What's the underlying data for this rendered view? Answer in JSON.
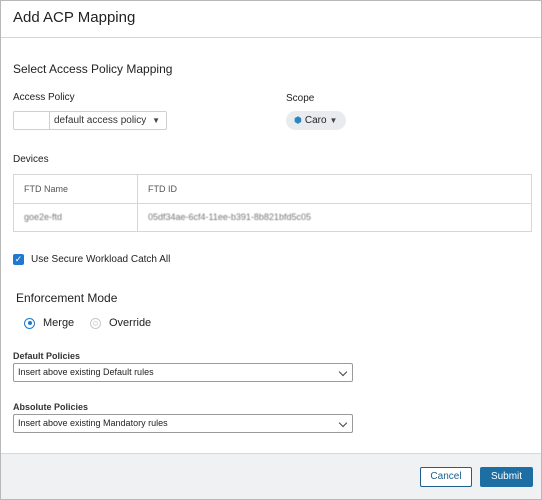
{
  "dialog": {
    "title": "Add ACP Mapping"
  },
  "section": {
    "title": "Select Access Policy Mapping"
  },
  "access_policy": {
    "label": "Access Policy",
    "value": "default access policy"
  },
  "scope": {
    "label": "Scope",
    "value": "Caro"
  },
  "devices": {
    "label": "Devices",
    "columns": [
      "FTD Name",
      "FTD ID"
    ],
    "rows": [
      {
        "name": "goe2e-ftd",
        "id": "05df34ae-6cf4-11ee-b391-8b821bfd5c05"
      }
    ]
  },
  "catch_all": {
    "label": "Use Secure Workload Catch All",
    "checked": true
  },
  "enforcement": {
    "title": "Enforcement Mode",
    "options": [
      {
        "label": "Merge",
        "selected": true
      },
      {
        "label": "Override",
        "selected": false
      }
    ]
  },
  "default_policies": {
    "label": "Default Policies",
    "value": "Insert above existing Default rules"
  },
  "absolute_policies": {
    "label": "Absolute Policies",
    "value": "Insert above existing Mandatory rules"
  },
  "footer": {
    "cancel_label": "Cancel",
    "submit_label": "Submit"
  },
  "colors": {
    "accent": "#1f79d1",
    "submit": "#1d6fa3",
    "footer_bg": "#f0f1f3"
  }
}
